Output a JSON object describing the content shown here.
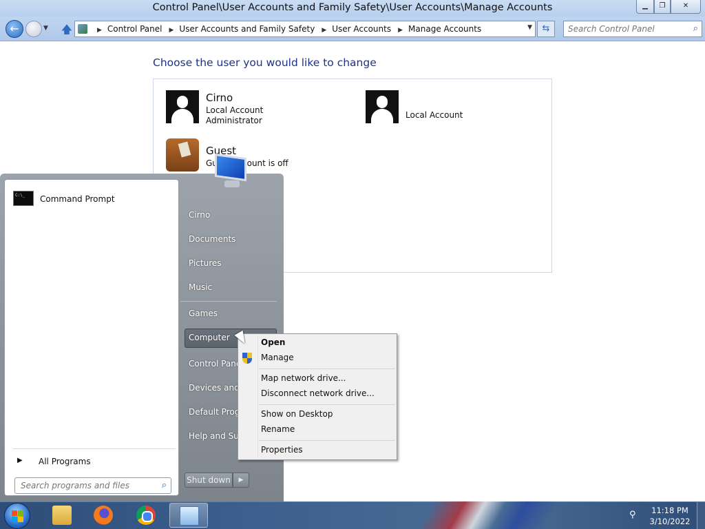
{
  "window": {
    "title": "Control Panel\\User Accounts and Family Safety\\User Accounts\\Manage Accounts"
  },
  "address_bar": {
    "breadcrumbs": [
      "Control Panel",
      "User Accounts and Family Safety",
      "User Accounts",
      "Manage Accounts"
    ],
    "search_placeholder": "Search Control Panel"
  },
  "content": {
    "heading": "Choose the user you would like to change",
    "accounts": [
      {
        "name": "Cirno",
        "line1": "Local Account",
        "line2": "Administrator"
      },
      {
        "name": "",
        "line1": "Local Account",
        "line2": ""
      },
      {
        "name": "Guest",
        "line1": "Guest account is off",
        "line2": ""
      }
    ]
  },
  "start_menu": {
    "pinned": [
      {
        "label": "Command Prompt",
        "icon": "command-prompt-icon"
      }
    ],
    "all_programs": "All Programs",
    "search_placeholder": "Search programs and files",
    "right_links": [
      "Cirno",
      "Documents",
      "Pictures",
      "Music",
      "Games",
      "Computer",
      "Control Panel",
      "Devices and Printers",
      "Default Programs",
      "Help and Support"
    ],
    "selected": "Computer",
    "shutdown_label": "Shut down"
  },
  "context_menu": {
    "items": [
      {
        "label": "Open",
        "bold": true
      },
      {
        "label": "Manage",
        "icon": "uac-shield-icon"
      },
      {
        "label": "Map network drive..."
      },
      {
        "label": "Disconnect network drive..."
      },
      {
        "label": "Show on Desktop"
      },
      {
        "label": "Rename"
      },
      {
        "label": "Properties"
      }
    ]
  },
  "taskbar": {
    "apps": [
      "windows-explorer-icon",
      "firefox-icon",
      "chrome-icon",
      "control-panel-icon"
    ],
    "active_app": "control-panel-icon",
    "clock_time": "11:18 PM",
    "clock_date": "3/10/2022"
  },
  "colors": {
    "heading": "#1e3287",
    "titlebar": "#c9dcf3",
    "taskbar": "#3a5d8c"
  }
}
